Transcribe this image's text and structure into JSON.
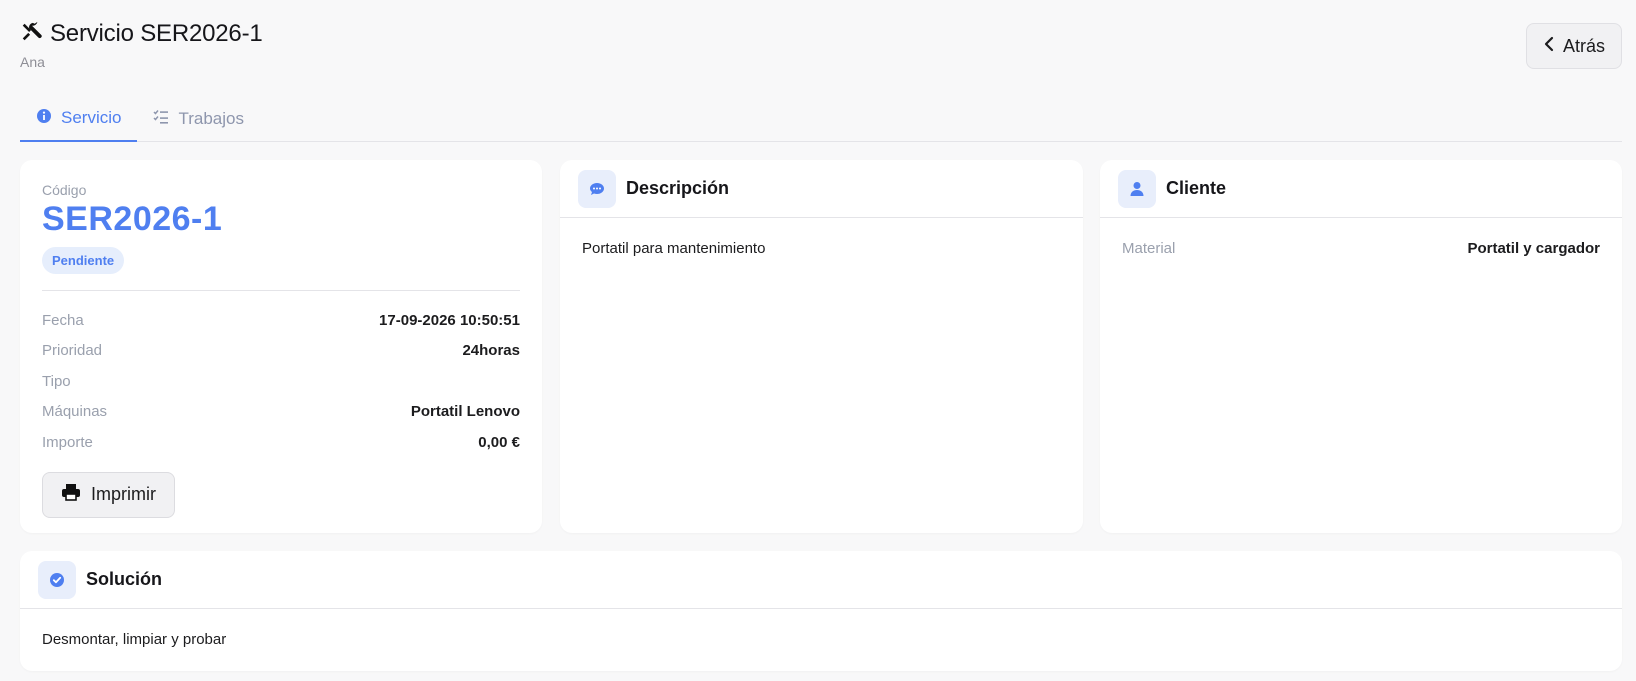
{
  "header": {
    "title": "Servicio SER2026-1",
    "subtitle": "Ana",
    "icon": "tools-icon",
    "back_label": "Atrás"
  },
  "tabs": [
    {
      "label": "Servicio",
      "icon": "info-icon",
      "active": true
    },
    {
      "label": "Trabajos",
      "icon": "checklist-icon",
      "active": false
    }
  ],
  "summary": {
    "code_label": "Código",
    "code": "SER2026-1",
    "status": "Pendiente",
    "rows": [
      {
        "label": "Fecha",
        "value": "17-09-2026 10:50:51"
      },
      {
        "label": "Prioridad",
        "value": "24horas"
      },
      {
        "label": "Tipo",
        "value": ""
      },
      {
        "label": "Máquinas",
        "value": "Portatil Lenovo"
      },
      {
        "label": "Importe",
        "value": "0,00 €"
      }
    ],
    "print_label": "Imprimir"
  },
  "description": {
    "title": "Descripción",
    "text": "Portatil para mantenimiento"
  },
  "client": {
    "title": "Cliente",
    "material_label": "Material",
    "material_value": "Portatil y cargador"
  },
  "solution": {
    "title": "Solución",
    "text": "Desmontar, limpiar y probar"
  },
  "colors": {
    "accent": "#4f7ff0",
    "badge_bg": "#e6eefc",
    "muted": "#9aa0ad"
  }
}
